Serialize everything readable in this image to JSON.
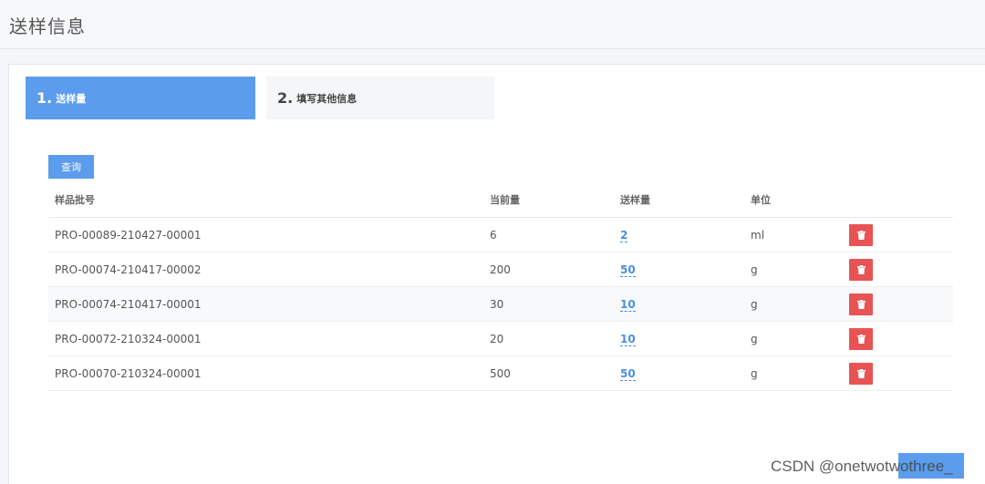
{
  "page": {
    "title": "送样信息"
  },
  "steps": [
    {
      "num": "1.",
      "label": "送样量",
      "active": true
    },
    {
      "num": "2.",
      "label": "填写其他信息",
      "active": false
    }
  ],
  "toolbar": {
    "query_label": "查询"
  },
  "table": {
    "headers": {
      "batch": "样品批号",
      "current": "当前量",
      "sent": "送样量",
      "unit": "单位"
    },
    "rows": [
      {
        "batch": "PRO-00089-210427-00001",
        "current": "6",
        "sent": "2",
        "unit": "ml"
      },
      {
        "batch": "PRO-00074-210417-00002",
        "current": "200",
        "sent": "50",
        "unit": "g"
      },
      {
        "batch": "PRO-00074-210417-00001",
        "current": "30",
        "sent": "10",
        "unit": "g"
      },
      {
        "batch": "PRO-00072-210324-00001",
        "current": "20",
        "sent": "10",
        "unit": "g"
      },
      {
        "batch": "PRO-00070-210324-00001",
        "current": "500",
        "sent": "50",
        "unit": "g"
      }
    ]
  },
  "icons": {
    "delete": "trash-icon"
  },
  "colors": {
    "primary": "#5b9cec",
    "danger": "#e85454",
    "link": "#4a8fdf"
  },
  "watermark": "CSDN @onetwotwothree_"
}
